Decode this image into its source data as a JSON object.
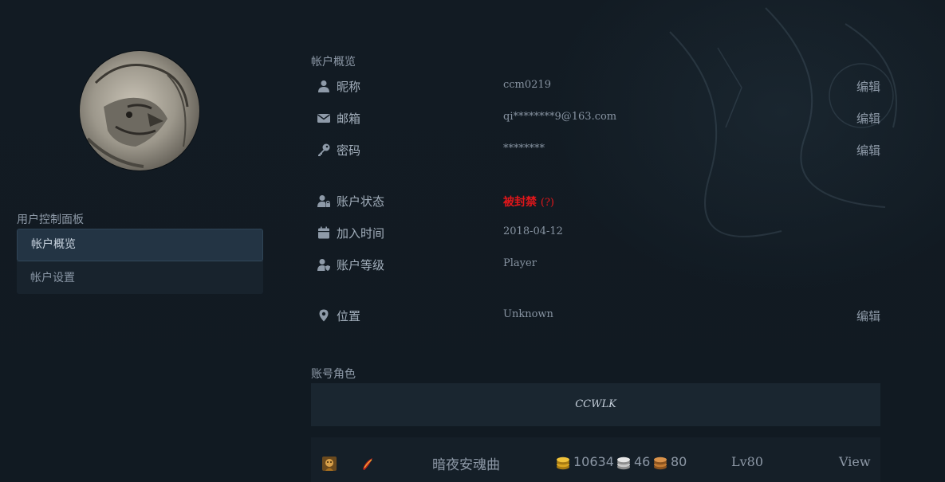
{
  "sidebar": {
    "title": "用户控制面板",
    "items": [
      {
        "label": "帐户概览",
        "active": true
      },
      {
        "label": "帐户设置",
        "active": false
      }
    ]
  },
  "overview": {
    "title": "帐户概览",
    "rows": [
      {
        "icon": "user-icon",
        "label": "昵称",
        "value": "ccm0219",
        "edit": "编辑"
      },
      {
        "icon": "envelope-icon",
        "label": "邮箱",
        "value": "qi********9@163.com",
        "edit": "编辑"
      },
      {
        "icon": "key-icon",
        "label": "密码",
        "value": "********",
        "edit": "编辑"
      },
      {
        "icon": "user-lock-icon",
        "label": "账户状态",
        "value": "被封禁",
        "value_suffix": "(?)",
        "value_color": "#e0161a"
      },
      {
        "icon": "calendar-icon",
        "label": "加入时间",
        "value": "2018-04-12"
      },
      {
        "icon": "user-shield-icon",
        "label": "账户等级",
        "value": "Player"
      },
      {
        "icon": "map-marker-icon",
        "label": "位置",
        "value": "Unknown",
        "edit": "编辑"
      }
    ]
  },
  "characters": {
    "title": "账号角色",
    "realm": "CCWLK",
    "list": [
      {
        "race_icon": "race-portrait-icon",
        "class_icon": "class-emblem-icon",
        "name": "暗夜安魂曲",
        "gold": "10634",
        "silver": "46",
        "copper": "80",
        "level": "Lv80",
        "action": "View"
      }
    ]
  },
  "colors": {
    "background": "#111a22",
    "banned": "#e0161a",
    "gold": "#d9a520",
    "silver": "#c8c8c8",
    "copper": "#c27a32"
  }
}
